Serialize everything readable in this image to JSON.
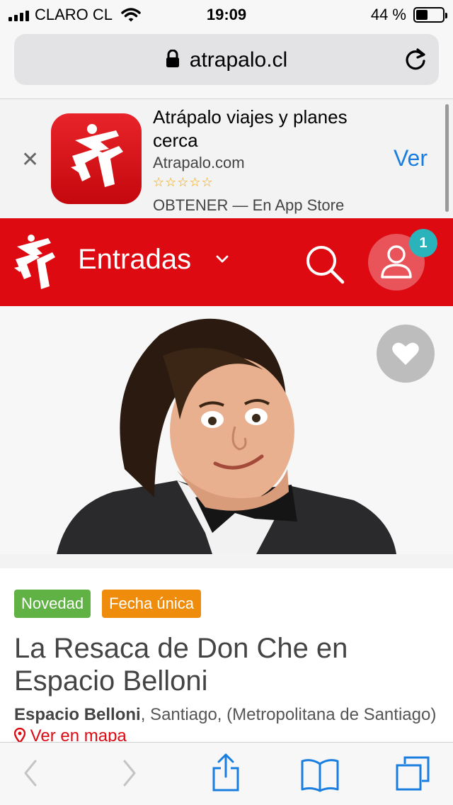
{
  "status_bar": {
    "carrier": "CLARO CL",
    "time": "19:09",
    "battery_percent": "44 %",
    "battery_level": 0.44
  },
  "browser": {
    "url": "atrapalo.cl"
  },
  "app_banner": {
    "title": "Atrápalo viajes y planes cerca",
    "developer": "Atrapalo.com",
    "rating_stars": "☆☆☆☆☆",
    "get_text": "OBTENER — En App Store",
    "view_label": "Ver",
    "icon_color": "#e0161d"
  },
  "site_header": {
    "section": "Entradas",
    "notification_count": "1",
    "brand_color": "#dd0a12"
  },
  "event": {
    "tags": [
      "Novedad",
      "Fecha única"
    ],
    "title": "La Resaca de Don Che en Espacio Belloni",
    "venue": "Espacio Belloni",
    "location": ", Santiago, (Metropolitana de Santiago)",
    "map_link": "Ver en mapa"
  },
  "icons": {
    "close": "close-icon",
    "search": "search-icon",
    "user": "user-icon",
    "favorite": "heart-icon",
    "back": "chevron-left-icon",
    "forward": "chevron-right-icon",
    "share": "share-icon",
    "bookmarks": "book-icon",
    "tabs": "tabs-icon"
  }
}
